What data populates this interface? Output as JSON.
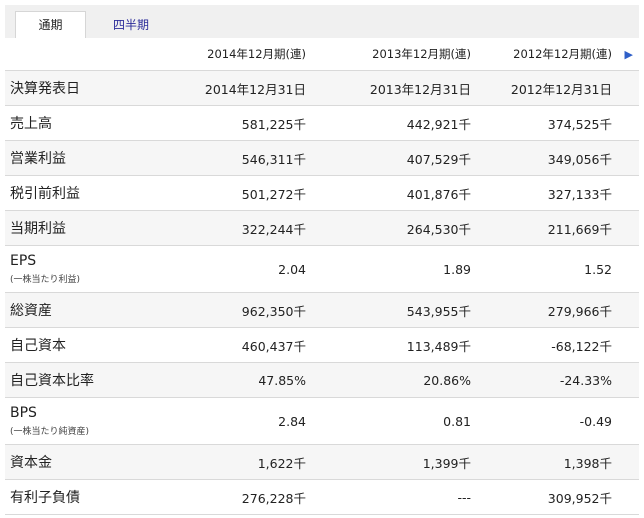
{
  "tabs": [
    {
      "label": "通期",
      "active": true
    },
    {
      "label": "四半期",
      "active": false
    }
  ],
  "columns": [
    "2014年12月期(連)",
    "2013年12月期(連)",
    "2012年12月期(連)"
  ],
  "next_arrow": "▶",
  "rows": [
    {
      "label": "決算発表日",
      "values": [
        "2014年12月31日",
        "2013年12月31日",
        "2012年12月31日"
      ]
    },
    {
      "label": "売上高",
      "values": [
        "581,225千",
        "442,921千",
        "374,525千"
      ]
    },
    {
      "label": "営業利益",
      "values": [
        "546,311千",
        "407,529千",
        "349,056千"
      ]
    },
    {
      "label": "税引前利益",
      "values": [
        "501,272千",
        "401,876千",
        "327,133千"
      ]
    },
    {
      "label": "当期利益",
      "values": [
        "322,244千",
        "264,530千",
        "211,669千"
      ]
    },
    {
      "label": "EPS",
      "sublabel": "(一株当たり利益)",
      "values": [
        "2.04",
        "1.89",
        "1.52"
      ]
    },
    {
      "label": "総資産",
      "values": [
        "962,350千",
        "543,955千",
        "279,966千"
      ]
    },
    {
      "label": "自己資本",
      "values": [
        "460,437千",
        "113,489千",
        "-68,122千"
      ]
    },
    {
      "label": "自己資本比率",
      "values": [
        "47.85%",
        "20.86%",
        "-24.33%"
      ]
    },
    {
      "label": "BPS",
      "sublabel": "(一株当たり純資産)",
      "values": [
        "2.84",
        "0.81",
        "-0.49"
      ]
    },
    {
      "label": "資本金",
      "values": [
        "1,622千",
        "1,399千",
        "1,398千"
      ]
    },
    {
      "label": "有利子負債",
      "values": [
        "276,228千",
        "---",
        "309,952千"
      ]
    }
  ]
}
